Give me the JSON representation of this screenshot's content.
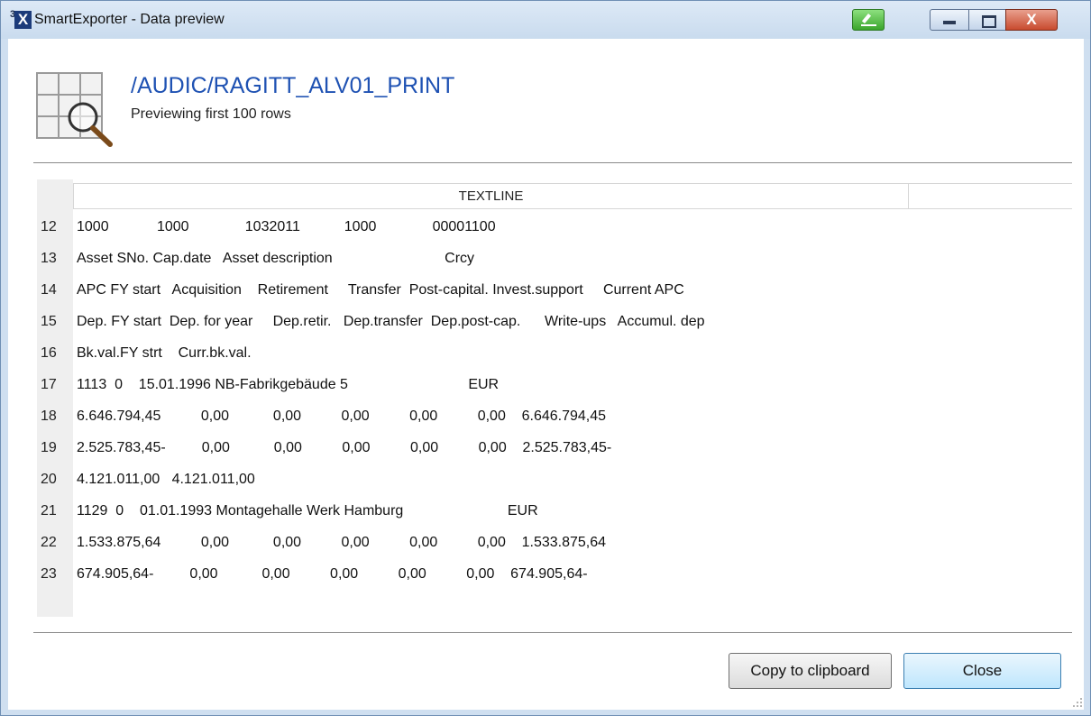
{
  "window": {
    "title": "SmartExporter - Data preview",
    "logo_superscript": "3",
    "logo_letter": "X",
    "close_glyph": "X"
  },
  "header": {
    "icon": "table-magnifier-icon",
    "title": "/AUDIC/RAGITT_ALV01_PRINT",
    "subtitle": "Previewing first 100 rows"
  },
  "grid": {
    "column_header": "TEXTLINE",
    "rows": [
      {
        "num": "12",
        "text": "1000            1000              1032011           1000              00001100"
      },
      {
        "num": "13",
        "text": "Asset SNo. Cap.date   Asset description                            Crcy"
      },
      {
        "num": "14",
        "text": "APC FY start   Acquisition    Retirement     Transfer  Post-capital. Invest.support     Current APC"
      },
      {
        "num": "15",
        "text": "Dep. FY start  Dep. for year     Dep.retir.   Dep.transfer  Dep.post-cap.      Write-ups   Accumul. dep"
      },
      {
        "num": "16",
        "text": "Bk.val.FY strt    Curr.bk.val."
      },
      {
        "num": "17",
        "text": "1113  0    15.01.1996 NB-Fabrikgebäude 5                              EUR"
      },
      {
        "num": "18",
        "text": "6.646.794,45          0,00           0,00          0,00          0,00          0,00    6.646.794,45"
      },
      {
        "num": "19",
        "text": "2.525.783,45-         0,00           0,00          0,00          0,00          0,00    2.525.783,45-"
      },
      {
        "num": "20",
        "text": "4.121.011,00   4.121.011,00"
      },
      {
        "num": "21",
        "text": "1129  0    01.01.1993 Montagehalle Werk Hamburg                          EUR"
      },
      {
        "num": "22",
        "text": "1.533.875,64          0,00           0,00          0,00          0,00          0,00    1.533.875,64"
      },
      {
        "num": "23",
        "text": "674.905,64-         0,00           0,00          0,00          0,00          0,00    674.905,64-"
      }
    ]
  },
  "buttons": {
    "copy": "Copy to clipboard",
    "close": "Close"
  },
  "colors": {
    "title_blue": "#1f52b3",
    "close_red": "#c84a2e",
    "edit_green": "#3aa52b"
  }
}
